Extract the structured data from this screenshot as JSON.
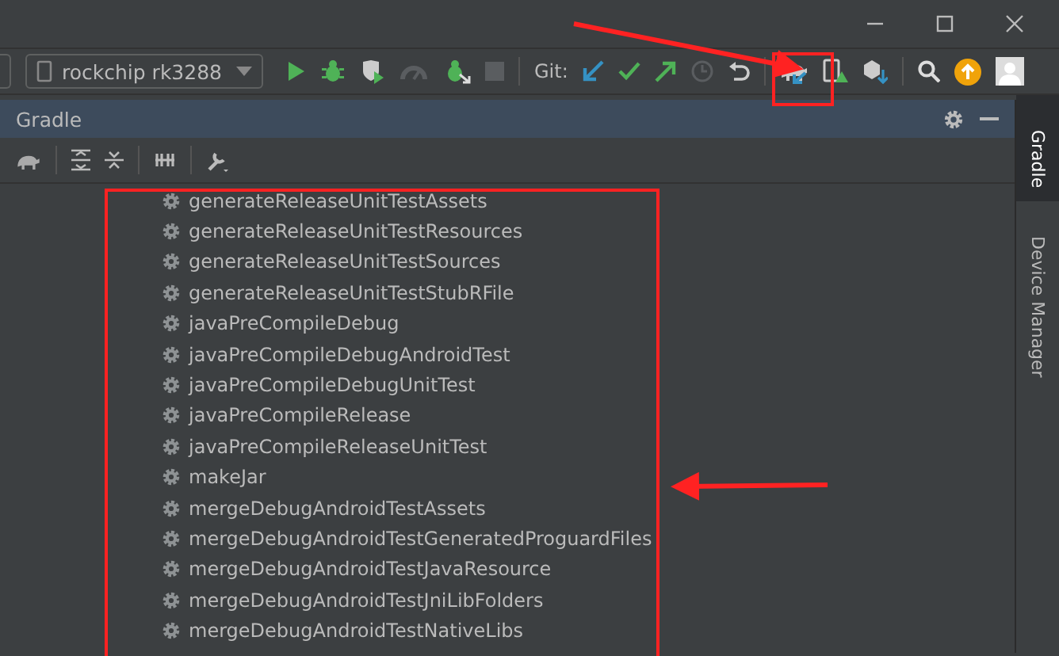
{
  "toolbar": {
    "device": "rockchip rk3288",
    "vcs_label": "Git:"
  },
  "panel": {
    "title": "Gradle"
  },
  "tasks": [
    "generateReleaseUnitTestAssets",
    "generateReleaseUnitTestResources",
    "generateReleaseUnitTestSources",
    "generateReleaseUnitTestStubRFile",
    "javaPreCompileDebug",
    "javaPreCompileDebugAndroidTest",
    "javaPreCompileDebugUnitTest",
    "javaPreCompileRelease",
    "javaPreCompileReleaseUnitTest",
    "makeJar",
    "mergeDebugAndroidTestAssets",
    "mergeDebugAndroidTestGeneratedProguardFiles",
    "mergeDebugAndroidTestJavaResource",
    "mergeDebugAndroidTestJniLibFolders",
    "mergeDebugAndroidTestNativeLibs"
  ],
  "side_tabs": [
    {
      "label": "Gradle",
      "selected": true
    },
    {
      "label": "Device Manager",
      "selected": false
    }
  ]
}
